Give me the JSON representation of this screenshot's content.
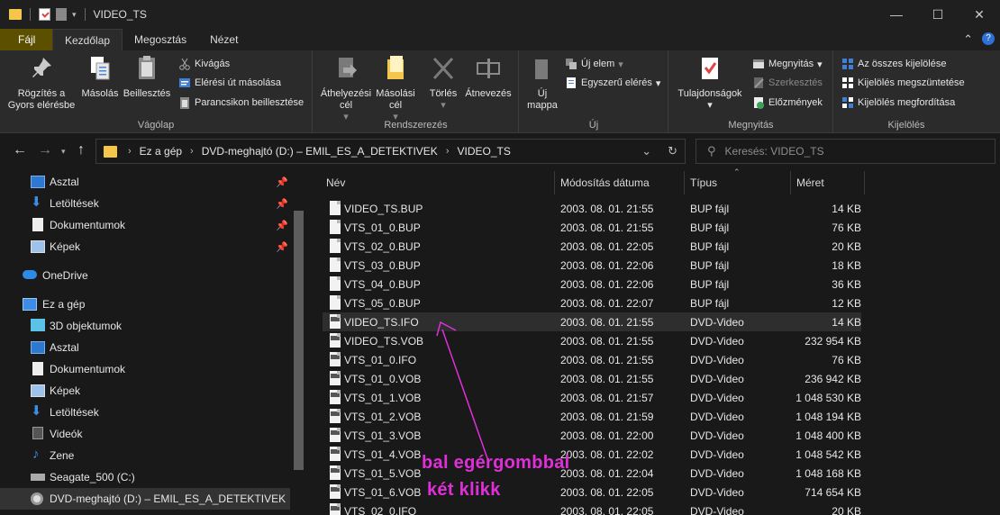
{
  "window": {
    "title": "VIDEO_TS",
    "minimize": "—",
    "maximize": "☐",
    "close": "✕"
  },
  "ribbon_tabs": [
    "Fájl",
    "Kezdőlap",
    "Megosztás",
    "Nézet"
  ],
  "ribbon": {
    "vagolap": {
      "label": "Vágólap",
      "pin": "Rögzítés a Gyors elérésbe",
      "copy": "Másolás",
      "paste": "Beillesztés",
      "cut": "Kivágás",
      "copy_path": "Elérési út másolása",
      "paste_shortcut": "Parancsikon beillesztése"
    },
    "rendszerezes": {
      "label": "Rendszerezés",
      "move": "Áthelyezési cél",
      "copy_to": "Másolási cél",
      "delete": "Törlés",
      "rename": "Átnevezés"
    },
    "uj": {
      "label": "Új",
      "new_folder": "Új mappa",
      "new_item": "Új elem",
      "easy_access": "Egyszerű elérés"
    },
    "megnyitas": {
      "label": "Megnyitás",
      "properties": "Tulajdonságok",
      "open": "Megnyitás",
      "edit": "Szerkesztés",
      "history": "Előzmények"
    },
    "kijeloles": {
      "label": "Kijelölés",
      "select_all": "Az összes kijelölése",
      "select_none": "Kijelölés megszüntetése",
      "invert": "Kijelölés megfordítása"
    }
  },
  "address": {
    "crumbs": [
      "Ez a gép",
      "DVD-meghajtó (D:) – EMIL_ES_A_DETEKTIVEK",
      "VIDEO_TS"
    ],
    "search_placeholder": "Keresés: VIDEO_TS"
  },
  "sidebar": {
    "quick_access": [
      "Asztal",
      "Letöltések",
      "Dokumentumok",
      "Képek"
    ],
    "onedrive": "OneDrive",
    "this_pc": "Ez a gép",
    "pc_items": [
      "3D objektumok",
      "Asztal",
      "Dokumentumok",
      "Képek",
      "Letöltések",
      "Videók",
      "Zene",
      "Seagate_500 (C:)",
      "DVD-meghajtó (D:) – EMIL_ES_A_DETEKTIVEK"
    ]
  },
  "columns": {
    "name": "Név",
    "date": "Módosítás dátuma",
    "type": "Típus",
    "size": "Méret"
  },
  "files": [
    {
      "name": "VIDEO_TS.BUP",
      "date": "2003. 08. 01. 21:55",
      "type": "BUP fájl",
      "size": "14 KB"
    },
    {
      "name": "VTS_01_0.BUP",
      "date": "2003. 08. 01. 21:55",
      "type": "BUP fájl",
      "size": "76 KB"
    },
    {
      "name": "VTS_02_0.BUP",
      "date": "2003. 08. 01. 22:05",
      "type": "BUP fájl",
      "size": "20 KB"
    },
    {
      "name": "VTS_03_0.BUP",
      "date": "2003. 08. 01. 22:06",
      "type": "BUP fájl",
      "size": "18 KB"
    },
    {
      "name": "VTS_04_0.BUP",
      "date": "2003. 08. 01. 22:06",
      "type": "BUP fájl",
      "size": "36 KB"
    },
    {
      "name": "VTS_05_0.BUP",
      "date": "2003. 08. 01. 22:07",
      "type": "BUP fájl",
      "size": "12 KB"
    },
    {
      "name": "VIDEO_TS.IFO",
      "date": "2003. 08. 01. 21:55",
      "type": "DVD-Video",
      "size": "14 KB"
    },
    {
      "name": "VIDEO_TS.VOB",
      "date": "2003. 08. 01. 21:55",
      "type": "DVD-Video",
      "size": "232 954 KB"
    },
    {
      "name": "VTS_01_0.IFO",
      "date": "2003. 08. 01. 21:55",
      "type": "DVD-Video",
      "size": "76 KB"
    },
    {
      "name": "VTS_01_0.VOB",
      "date": "2003. 08. 01. 21:55",
      "type": "DVD-Video",
      "size": "236 942 KB"
    },
    {
      "name": "VTS_01_1.VOB",
      "date": "2003. 08. 01. 21:57",
      "type": "DVD-Video",
      "size": "1 048 530 KB"
    },
    {
      "name": "VTS_01_2.VOB",
      "date": "2003. 08. 01. 21:59",
      "type": "DVD-Video",
      "size": "1 048 194 KB"
    },
    {
      "name": "VTS_01_3.VOB",
      "date": "2003. 08. 01. 22:00",
      "type": "DVD-Video",
      "size": "1 048 400 KB"
    },
    {
      "name": "VTS_01_4.VOB",
      "date": "2003. 08. 01. 22:02",
      "type": "DVD-Video",
      "size": "1 048 542 KB"
    },
    {
      "name": "VTS_01_5.VOB",
      "date": "2003. 08. 01. 22:04",
      "type": "DVD-Video",
      "size": "1 048 168 KB"
    },
    {
      "name": "VTS_01_6.VOB",
      "date": "2003. 08. 01. 22:05",
      "type": "DVD-Video",
      "size": "714 654 KB"
    },
    {
      "name": "VTS_02_0.IFO",
      "date": "2003. 08. 01. 22:05",
      "type": "DVD-Video",
      "size": "20 KB"
    }
  ],
  "annotation": {
    "line1": "bal egérgombbal",
    "line2": "két klikk",
    "color": "#e02fd8"
  }
}
